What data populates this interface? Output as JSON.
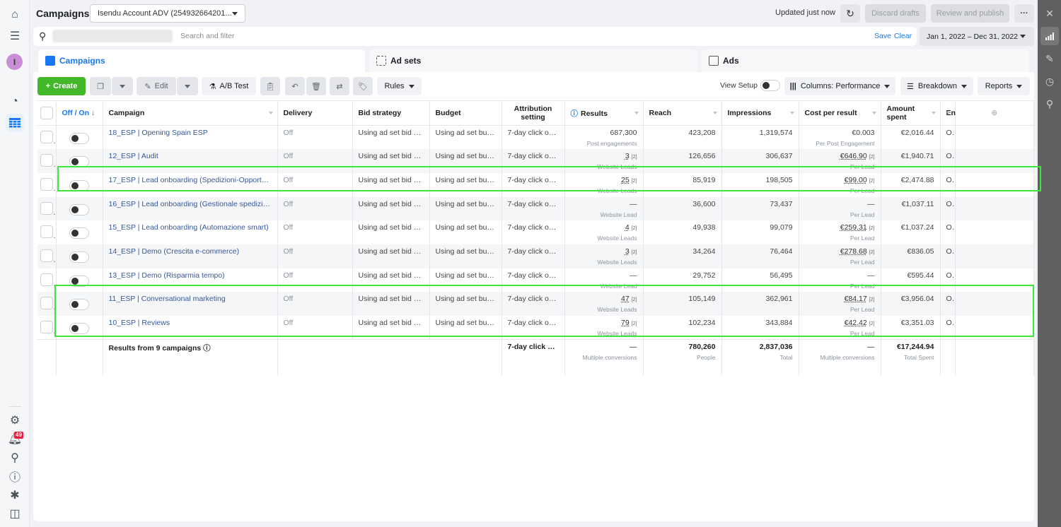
{
  "app": {
    "title": "Campaigns",
    "account": "Isendu Account ADV (254932664201...",
    "updated": "Updated just now",
    "discard_drafts": "Discard drafts",
    "review_publish": "Review and publish",
    "more": "···"
  },
  "leftnav": {
    "avatar_initial": "I",
    "notifications_count": "49"
  },
  "search": {
    "placeholder": "Search and filter",
    "save": "Save",
    "clear": "Clear",
    "date_range": "Jan 1, 2022 – Dec 31, 2022"
  },
  "tabs": [
    {
      "label": "Campaigns"
    },
    {
      "label": "Ad sets"
    },
    {
      "label": "Ads"
    }
  ],
  "toolbar": {
    "create": "Create",
    "edit": "Edit",
    "ab_test": "A/B Test",
    "rules": "Rules",
    "view_setup": "View Setup",
    "columns": "Columns: Performance",
    "breakdown": "Breakdown",
    "reports": "Reports"
  },
  "table": {
    "headers": {
      "onoff": "Off / On ↓",
      "campaign": "Campaign",
      "delivery": "Delivery",
      "bid": "Bid strategy",
      "budget": "Budget",
      "attribution": "Attribution setting",
      "results": "Results",
      "reach": "Reach",
      "impressions": "Impressions",
      "cpr": "Cost per result",
      "spent": "Amount spent",
      "ends": "Ends"
    },
    "rows": [
      {
        "campaign": "18_ESP | Opening Spain ESP",
        "delivery": "Off",
        "bid": "Using ad set bid s...",
        "budget": "Using ad set bud...",
        "attribution": "7-day click or ...",
        "results": "687,300",
        "results_label": "Post engagements",
        "reach": "423,208",
        "impressions": "1,319,574",
        "cpr": "€0.003",
        "cpr_label": "Per Post Engagement",
        "spent": "€2,016.44",
        "ends": "Ongoing"
      },
      {
        "campaign": "12_ESP | Audit",
        "delivery": "Off",
        "bid": "Using ad set bid s...",
        "budget": "Using ad set bud...",
        "attribution": "7-day click or ...",
        "results": "3",
        "results_label": "Website Leads",
        "reach": "126,656",
        "impressions": "306,637",
        "cpr": "€646.90",
        "cpr_label": "Per Lead",
        "spent": "€1,940.71",
        "ends": "Ongoing"
      },
      {
        "campaign": "17_ESP | Lead onboarding (Spedizioni-Opportuni...",
        "delivery": "Off",
        "bid": "Using ad set bid s...",
        "budget": "Using ad set bud...",
        "attribution": "7-day click or ...",
        "results": "25",
        "results_label": "Website Leads",
        "reach": "85,919",
        "impressions": "198,505",
        "cpr": "€99.00",
        "cpr_label": "Per Lead",
        "spent": "€2,474.88",
        "ends": "Ongoing"
      },
      {
        "campaign": "16_ESP | Lead onboarding (Gestionale spedizioni)",
        "delivery": "Off",
        "bid": "Using ad set bid s...",
        "budget": "Using ad set bud...",
        "attribution": "7-day click or ...",
        "results": "—",
        "results_label": "Website Lead",
        "reach": "36,600",
        "impressions": "73,437",
        "cpr": "—",
        "cpr_label": "Per Lead",
        "spent": "€1,037.11",
        "ends": "Ongoing"
      },
      {
        "campaign": "15_ESP | Lead onboarding (Automazione smart)",
        "delivery": "Off",
        "bid": "Using ad set bid s...",
        "budget": "Using ad set bud...",
        "attribution": "7-day click or ...",
        "results": "4",
        "results_label": "Website Leads",
        "reach": "49,938",
        "impressions": "99,079",
        "cpr": "€259.31",
        "cpr_label": "Per Lead",
        "spent": "€1,037.24",
        "ends": "Ongoing"
      },
      {
        "campaign": "14_ESP | Demo (Crescita e-commerce)",
        "delivery": "Off",
        "bid": "Using ad set bid s...",
        "budget": "Using ad set bud...",
        "attribution": "7-day click or ...",
        "results": "3",
        "results_label": "Website Leads",
        "reach": "34,264",
        "impressions": "76,464",
        "cpr": "€278.68",
        "cpr_label": "Per Lead",
        "spent": "€836.05",
        "ends": "Ongoing"
      },
      {
        "campaign": "13_ESP | Demo (Risparmia tempo)",
        "delivery": "Off",
        "bid": "Using ad set bid s...",
        "budget": "Using ad set bud...",
        "attribution": "7-day click or ...",
        "results": "—",
        "results_label": "Website Lead",
        "reach": "29,752",
        "impressions": "56,495",
        "cpr": "—",
        "cpr_label": "Per Lead",
        "spent": "€595.44",
        "ends": "Ongoing"
      },
      {
        "campaign": "11_ESP | Conversational marketing",
        "delivery": "Off",
        "bid": "Using ad set bid s...",
        "budget": "Using ad set bud...",
        "attribution": "7-day click or ...",
        "results": "47",
        "results_label": "Website Leads",
        "reach": "105,149",
        "impressions": "362,961",
        "cpr": "€84.17",
        "cpr_label": "Per Lead",
        "spent": "€3,956.04",
        "ends": "Ongoing"
      },
      {
        "campaign": "10_ESP | Reviews",
        "delivery": "Off",
        "bid": "Using ad set bid s...",
        "budget": "Using ad set bud...",
        "attribution": "7-day click or ...",
        "results": "79",
        "results_label": "Website Leads",
        "reach": "102,234",
        "impressions": "343,884",
        "cpr": "€42.42",
        "cpr_label": "Per Lead",
        "spent": "€3,351.03",
        "ends": "Ongoing"
      }
    ],
    "totals": {
      "label": "Results from 9 campaigns",
      "attribution": "7-day click or ...",
      "results": "—",
      "results_label": "Multiple conversions",
      "reach": "780,260",
      "reach_label": "People",
      "impressions": "2,837,036",
      "impressions_label": "Total",
      "cpr": "—",
      "cpr_label": "Multiple conversions",
      "spent": "€17,244.94",
      "spent_label": "Total Spent"
    }
  },
  "colors": {
    "accent": "#1877f2",
    "create": "#42b72a",
    "highlight": "#3ce63c"
  }
}
